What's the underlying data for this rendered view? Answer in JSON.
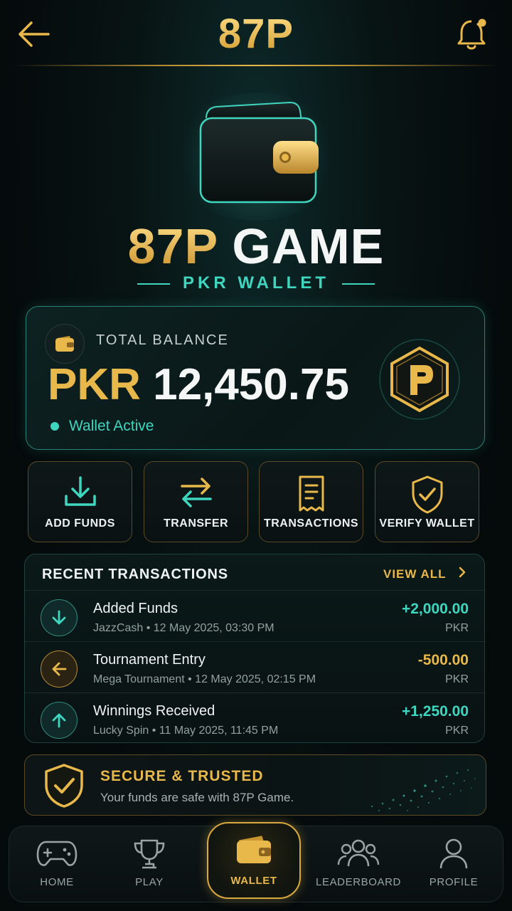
{
  "header": {
    "title": "87P"
  },
  "brand": {
    "name_part1": "87P",
    "name_part2": "GAME",
    "subtitle": "PKR WALLET"
  },
  "balance": {
    "label": "TOTAL BALANCE",
    "currency": "PKR",
    "amount": "12,450.75",
    "status": "Wallet Active"
  },
  "actions": [
    {
      "label": "ADD FUNDS",
      "icon": "download-icon"
    },
    {
      "label": "TRANSFER",
      "icon": "swap-arrows-icon"
    },
    {
      "label": "TRANSACTIONS",
      "icon": "receipt-icon"
    },
    {
      "label": "VERIFY WALLET",
      "icon": "shield-check-icon"
    }
  ],
  "recent": {
    "title": "RECENT TRANSACTIONS",
    "view_all": "VIEW ALL",
    "items": [
      {
        "title": "Added Funds",
        "detail": "JazzCash • 12 May 2025, 03:30 PM",
        "amount": "+2,000.00",
        "unit": "PKR",
        "type": "credit"
      },
      {
        "title": "Tournament Entry",
        "detail": "Mega Tournament • 12 May 2025, 02:15 PM",
        "amount": "-500.00",
        "unit": "PKR",
        "type": "debit"
      },
      {
        "title": "Winnings Received",
        "detail": "Lucky Spin • 11 May 2025, 11:45 PM",
        "amount": "+1,250.00",
        "unit": "PKR",
        "type": "credit"
      }
    ]
  },
  "secure": {
    "title": "SECURE & TRUSTED",
    "text": "Your funds are safe with 87P Game."
  },
  "nav": [
    {
      "label": "HOME",
      "icon": "gamepad-icon"
    },
    {
      "label": "PLAY",
      "icon": "trophy-icon"
    },
    {
      "label": "WALLET",
      "icon": "wallet-icon",
      "active": true
    },
    {
      "label": "LEADERBOARD",
      "icon": "users-icon"
    },
    {
      "label": "PROFILE",
      "icon": "user-icon"
    }
  ],
  "colors": {
    "gold": "#e8b84a",
    "teal": "#3fd6c0",
    "background": "#050a0b"
  }
}
